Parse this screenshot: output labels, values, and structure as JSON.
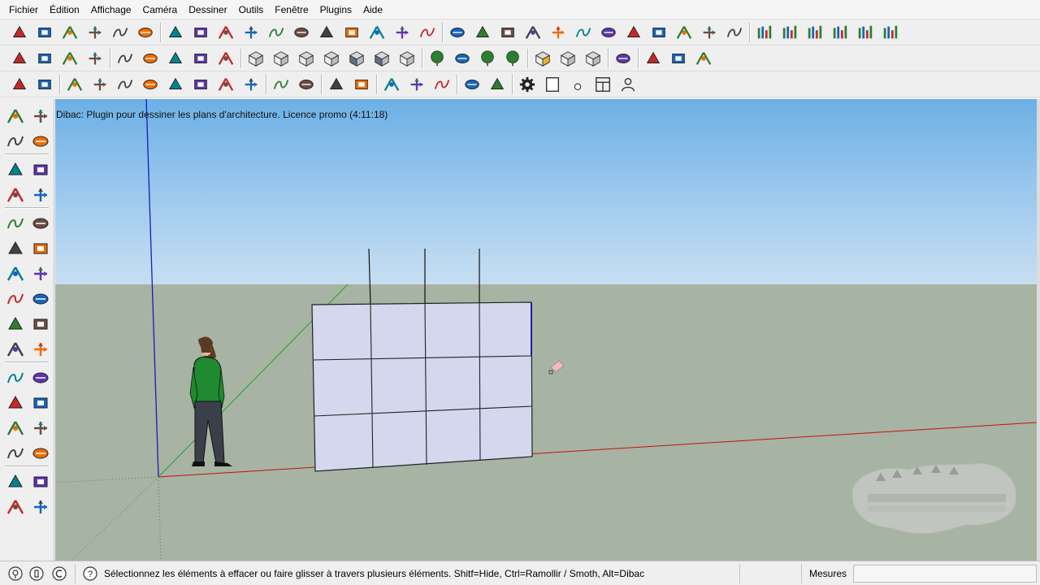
{
  "menu": [
    "Fichier",
    "Édition",
    "Affichage",
    "Caméra",
    "Dessiner",
    "Outils",
    "Fenêtre",
    "Plugins",
    "Aide"
  ],
  "plugin_message": "Dibac: Plugin pour dessiner les plans d'architecture. Licence promo (4:11:18)",
  "status": {
    "text": "Sélectionnez les éléments à effacer ou faire glisser à travers plusieurs éléments. Shitf=Hide, Ctrl=Ramollir / Smoth, Alt=Dibac",
    "measure_label": "Mesures",
    "measure_value": ""
  },
  "toolbar_row1": [
    "house-icon",
    "wall-icon",
    "home-icon",
    "window-icon",
    "roof-icon",
    "window-frame-icon",
    "door-icon",
    "stairs-down-icon",
    "arrows-horizontal-icon",
    "arc-door-icon",
    "line-icon",
    "angle-icon",
    "measure-icon",
    "chair-icon",
    "beam-icon",
    "column-icon",
    "truck-icon",
    "curve-icon",
    "spring-icon",
    "dome-icon",
    "angle-85-icon",
    "bend-icon",
    "push-up-icon",
    "grid-fence-icon",
    "push-pull-icon",
    "plate-icon",
    "points-icon",
    "roof-tile-icon",
    "roof-shape-icon",
    "bars-chart-1-icon",
    "bars-chart-2-icon",
    "bars-chart-3-icon",
    "bars-chart-4-icon",
    "bars-chart-5-icon",
    "bars-chart-6-icon"
  ],
  "toolbar_row2": [
    "color-select-icon",
    "bar-select-icon",
    "updown-arrows-icon",
    "up-arrows-icon",
    "diagonal-icon",
    "hourglass-icon",
    "undo-icon",
    "redo-icon",
    "redo-light-icon",
    "box-wire-icon",
    "box-iso-icon",
    "box-front-icon",
    "box-top-icon",
    "box-shaded-icon",
    "box-textured-icon",
    "box-mono-icon",
    "tree-icon",
    "grass-icon",
    "shrub-icon",
    "bush-icon",
    "cube-yellow-icon",
    "cube-cut-icon",
    "cube-section-icon",
    "mirror-icon",
    "sphere-wire-icon",
    "bulb-icon",
    "polyhedron-icon"
  ],
  "toolbar_row3": [
    "tag-icon",
    "pencil-red-icon",
    "offset-1-icon",
    "offset-2-icon",
    "offset-3-icon",
    "offset-4-icon",
    "offset-5-icon",
    "offset-6-icon",
    "offset-7-icon",
    "offset-8-icon",
    "path-blue-icon",
    "path-arc-icon",
    "ruler-red-icon",
    "eraser-pink-icon",
    "axis-1-icon",
    "axis-2-icon",
    "axis-3-icon",
    "move-1-icon",
    "move-2-icon",
    "gear-icon",
    "blank-page-icon",
    "circle-small-icon",
    "panels-icon",
    "user-icon"
  ],
  "left_tools": [
    "select-arrow-icon",
    "component-icon",
    "paint-bucket-icon",
    "eraser-icon",
    "rectangle-icon",
    "pencil-icon",
    "circle-icon",
    "arc-icon",
    "polygon-icon",
    "freehand-icon",
    "move-icon",
    "push-pull-icon",
    "rotate-icon",
    "follow-me-icon",
    "scale-icon",
    "offset-icon",
    "tape-measure-icon",
    "dimension-icon",
    "protractor-icon",
    "text-icon",
    "axes-icon",
    "3d-text-icon",
    "orbit-icon",
    "pan-icon",
    "zoom-icon",
    "zoom-extents-icon",
    "previous-view-icon",
    "next-view-icon",
    "position-camera-icon",
    "look-around-icon",
    "walk-icon",
    "section-icon"
  ],
  "status_icons": [
    "geolocation-icon",
    "credits-icon",
    "signin-icon",
    "help-icon"
  ]
}
